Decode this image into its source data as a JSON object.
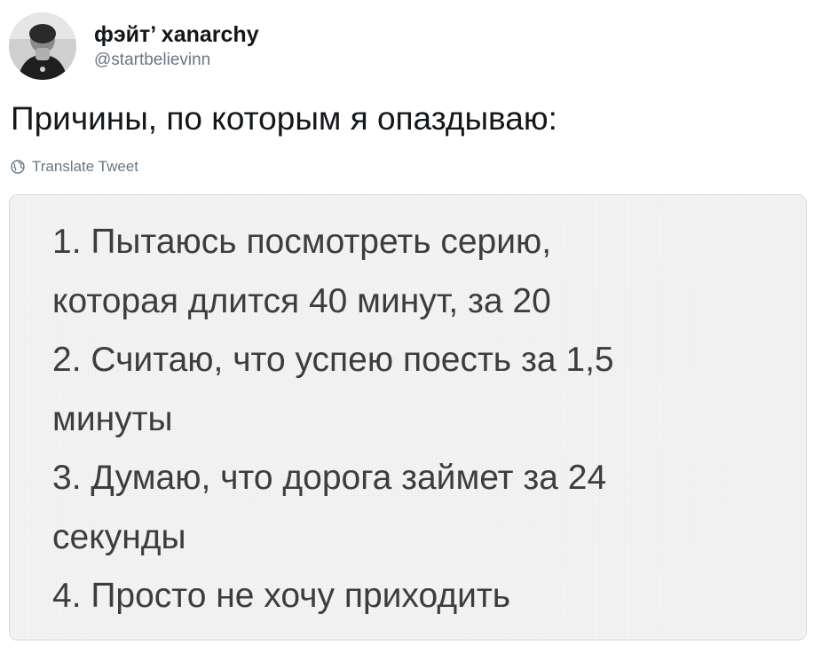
{
  "tweet": {
    "author": {
      "display_name": "фэйт’ xanarchy",
      "username": "@startbelievinn",
      "avatar_icon": "profile-photo-icon"
    },
    "text": "Причины, по которым я опаздываю:",
    "translate_label": "Translate Tweet",
    "translate_icon": "globe-icon"
  },
  "media": {
    "lines": [
      "1. Пытаюсь посмотреть серию,",
      "которая длится 40 минут, за 20",
      "2. Считаю, что успею поесть за 1,5",
      "минуты",
      "3. Думаю, что дорога займет за 24",
      "секунды",
      "4. Просто не хочу приходить"
    ]
  },
  "colors": {
    "text_primary": "#14171a",
    "text_secondary": "#657786",
    "media_background": "#f3f3f3",
    "media_text": "#3d3d3d"
  }
}
